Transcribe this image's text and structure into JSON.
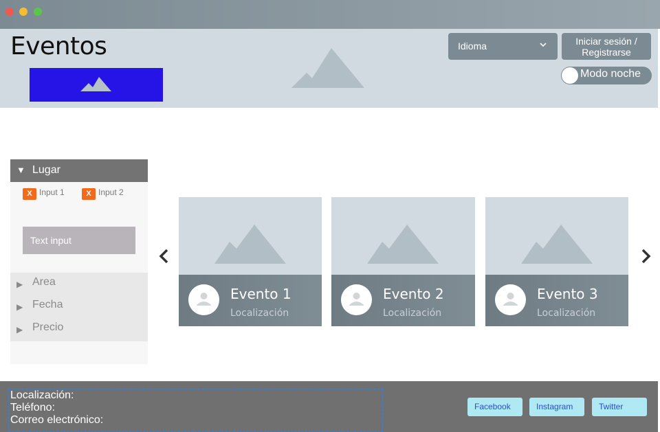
{
  "header": {
    "title": "Eventos",
    "language_select": "Idioma",
    "login_label": "Iniciar sesión / Registrarse",
    "night_mode_label": "Modo noche"
  },
  "filters": {
    "section_title": "Lugar",
    "chips": [
      "Input 1",
      "Input 2"
    ],
    "chip_remove_label": "X",
    "text_input_placeholder": "Text input",
    "collapsed_sections": [
      "Area",
      "Fecha",
      "Precio"
    ]
  },
  "carousel": {
    "cards": [
      {
        "title": "Evento 1",
        "location": "Localización"
      },
      {
        "title": "Evento 2",
        "location": "Localización"
      },
      {
        "title": "Evento 3",
        "location": "Localización"
      }
    ]
  },
  "footer": {
    "location_label": "Localización:",
    "phone_label": "Teléfono:",
    "email_label": "Correo electrónico:",
    "social": [
      "Facebook",
      "Instagram",
      "Twitter"
    ]
  },
  "colors": {
    "titlebar": "#7c8a93",
    "header_bg": "#d1dae0",
    "logo_placeholder": "#2614e6",
    "chip_remove": "#f26b1d",
    "footer_bg": "#707070",
    "social_button": "#aee9f4"
  }
}
